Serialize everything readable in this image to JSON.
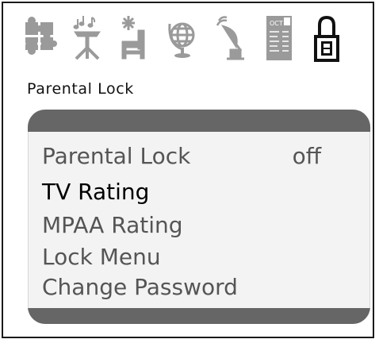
{
  "icons": [
    {
      "name": "puzzle-icon"
    },
    {
      "name": "music-stand-icon"
    },
    {
      "name": "chair-settings-icon"
    },
    {
      "name": "globe-icon"
    },
    {
      "name": "satellite-dish-icon"
    },
    {
      "name": "document-icon"
    },
    {
      "name": "padlock-icon",
      "selected": true
    }
  ],
  "page": {
    "title": "Parental Lock"
  },
  "menu": {
    "items": [
      {
        "label": "Parental Lock",
        "value": "off",
        "state": "normal"
      },
      {
        "label": "TV Rating",
        "state": "highlighted"
      },
      {
        "label": "MPAA  Rating",
        "state": "normal"
      },
      {
        "label": "Lock Menu",
        "state": "normal"
      },
      {
        "label": "Change Password",
        "state": "normal"
      }
    ]
  },
  "colors": {
    "item_normal": "#555555",
    "item_highlight": "#000000",
    "panel_bar": "#666666",
    "panel_bg": "#f3f3f3"
  },
  "icon_labels": {
    "document": "OCT"
  }
}
